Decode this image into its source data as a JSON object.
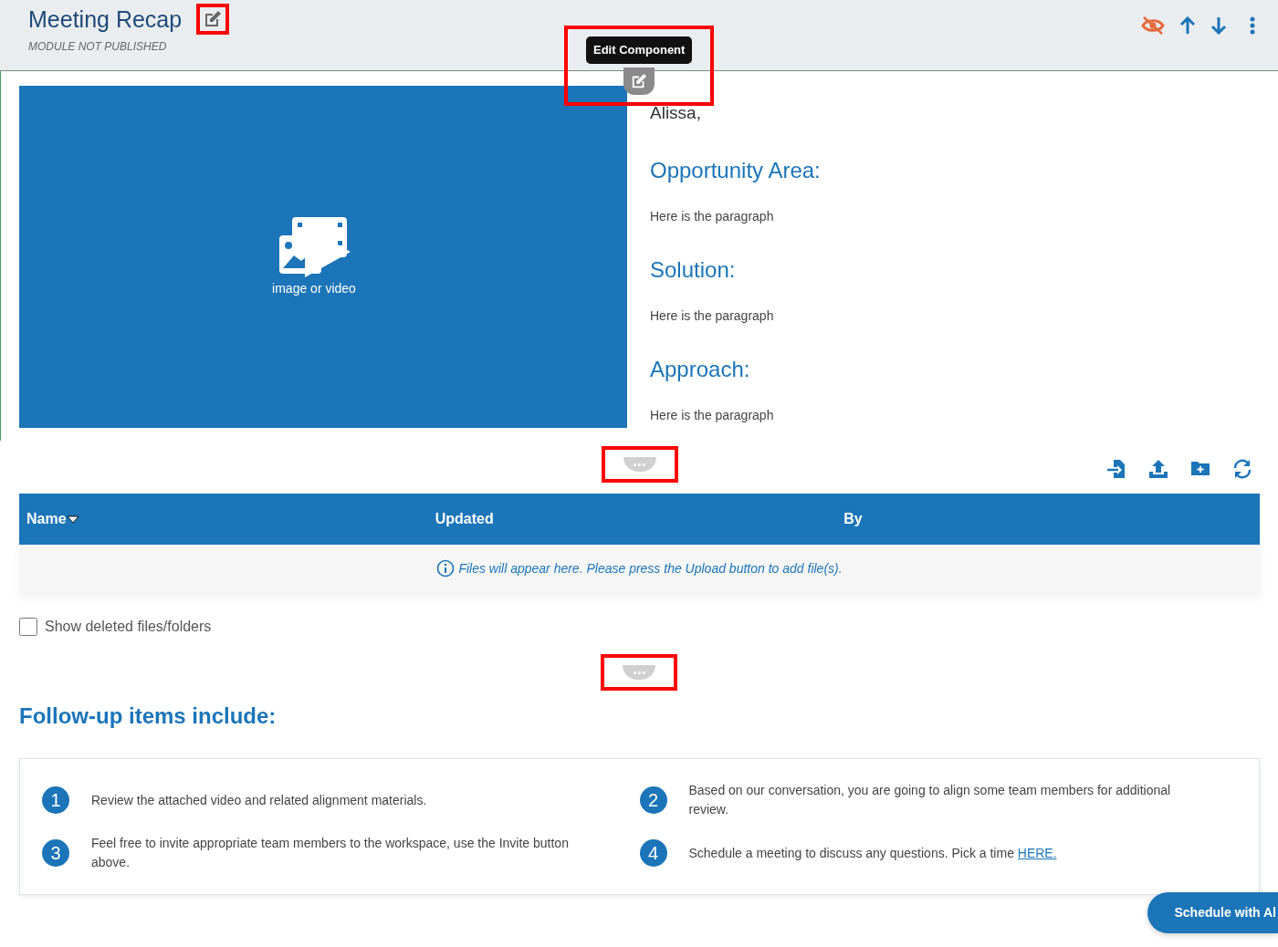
{
  "module": {
    "title": "Meeting Recap",
    "status": "MODULE NOT PUBLISHED",
    "edit_highlighted": true,
    "hidden": true
  },
  "edit_component": {
    "tooltip": "Edit Component",
    "highlighted": true
  },
  "media": {
    "caption": "image or video"
  },
  "content": {
    "greeting": "Alissa,",
    "sections": [
      {
        "heading": "Opportunity Area:",
        "paragraph": "Here is the paragraph"
      },
      {
        "heading": "Solution:",
        "paragraph": "Here is the paragraph"
      },
      {
        "heading": "Approach:",
        "paragraph": "Here is the paragraph"
      }
    ]
  },
  "dividers": [
    {
      "highlighted": true
    },
    {
      "highlighted": true
    }
  ],
  "files": {
    "columns": [
      {
        "label": "Name",
        "sorted": true
      },
      {
        "label": "Updated",
        "sorted": false
      },
      {
        "label": "By",
        "sorted": false
      }
    ],
    "empty_message": "Files will appear here. Please press the Upload button to add file(s).",
    "show_deleted": {
      "label": "Show deleted files/folders",
      "checked": false
    }
  },
  "followup": {
    "heading": "Follow-up items include:",
    "items": [
      {
        "number": "1",
        "text": "Review the attached video and related alignment materials."
      },
      {
        "number": "2",
        "text": "Based on our conversation, you are going to align some team members for additional review."
      },
      {
        "number": "3",
        "text": "Feel free to invite appropriate team members to the workspace, use the Invite button above."
      },
      {
        "number": "4",
        "text": "Schedule a meeting to discuss any questions. Pick a time ",
        "link": "HERE."
      }
    ]
  },
  "schedule_button": "Schedule with Al"
}
